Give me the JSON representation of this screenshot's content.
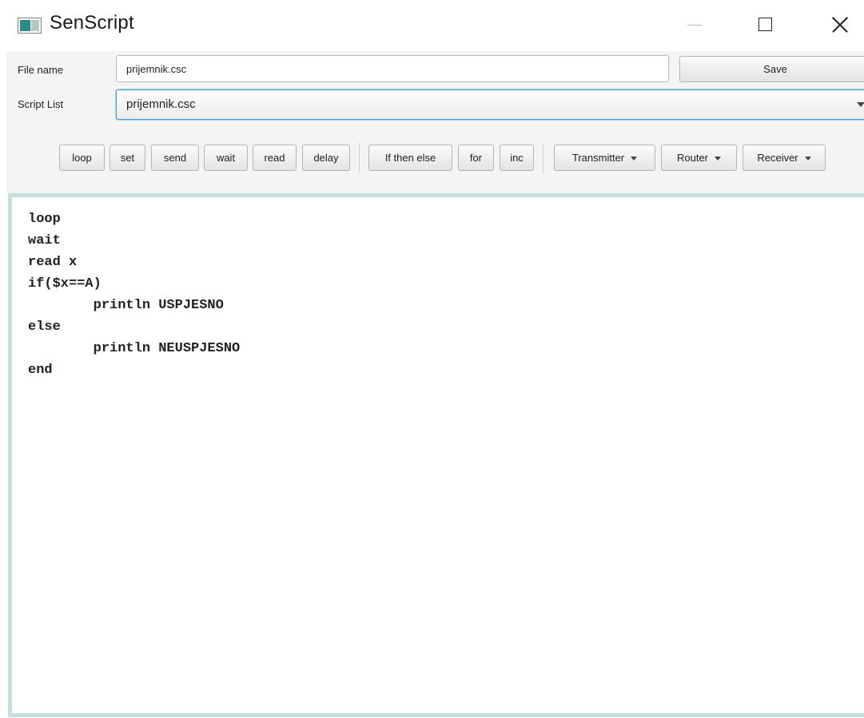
{
  "window": {
    "title": "SenScript",
    "controls": [
      "minimize-icon",
      "maximize-icon",
      "close-icon"
    ]
  },
  "form": {
    "file_name_label": "File name",
    "file_name_value": "prijemnik.csc",
    "save_label": "Save",
    "script_list_label": "Script List",
    "script_list_selected": "prijemnik.csc"
  },
  "toolbar": {
    "buttons": [
      "loop",
      "set",
      "send",
      "wait",
      "read",
      "delay",
      "If then else",
      "for",
      "inc"
    ],
    "dropdowns": [
      "Transmitter",
      "Router",
      "Receiver"
    ]
  },
  "editor": {
    "lines": [
      "loop",
      "wait",
      "read x",
      "if($x==A)",
      "        println USPJESNO",
      "else",
      "        println NEUSPJESNO",
      "end"
    ]
  },
  "colors": {
    "focus_border": "#3fa0d6",
    "editor_border": "#c7dede",
    "panel_bg": "#f4f4f4"
  }
}
